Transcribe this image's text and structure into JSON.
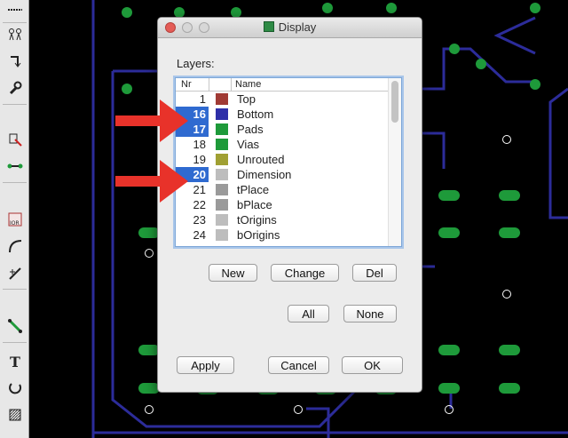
{
  "dialog": {
    "title": "Display",
    "layers_label": "Layers:",
    "columns": {
      "nr": "Nr",
      "name": "Name"
    },
    "layers": [
      {
        "nr": "1",
        "name": "Top",
        "color": "#a03a34",
        "selected": false
      },
      {
        "nr": "16",
        "name": "Bottom",
        "color": "#2e2fa8",
        "selected": true
      },
      {
        "nr": "17",
        "name": "Pads",
        "color": "#1e9a3a",
        "selected": true
      },
      {
        "nr": "18",
        "name": "Vias",
        "color": "#1e9a3a",
        "selected": false
      },
      {
        "nr": "19",
        "name": "Unrouted",
        "color": "#a0a033",
        "selected": false
      },
      {
        "nr": "20",
        "name": "Dimension",
        "color": "#bdbdbd",
        "selected": true
      },
      {
        "nr": "21",
        "name": "tPlace",
        "color": "#9a9a9a",
        "selected": false
      },
      {
        "nr": "22",
        "name": "bPlace",
        "color": "#9a9a9a",
        "selected": false
      },
      {
        "nr": "23",
        "name": "tOrigins",
        "color": "#bdbdbd",
        "selected": false
      },
      {
        "nr": "24",
        "name": "bOrigins",
        "color": "#bdbdbd",
        "selected": false
      }
    ],
    "buttons": {
      "new": "New",
      "change": "Change",
      "del": "Del",
      "all": "All",
      "none": "None",
      "apply": "Apply",
      "cancel": "Cancel",
      "ok": "OK"
    }
  },
  "colors": {
    "canvas_background": "#000000",
    "trace": "#2c2c9a",
    "pad": "#1e9a3a",
    "selection": "#2f6ad0",
    "annotation_arrow": "#e8322a"
  }
}
